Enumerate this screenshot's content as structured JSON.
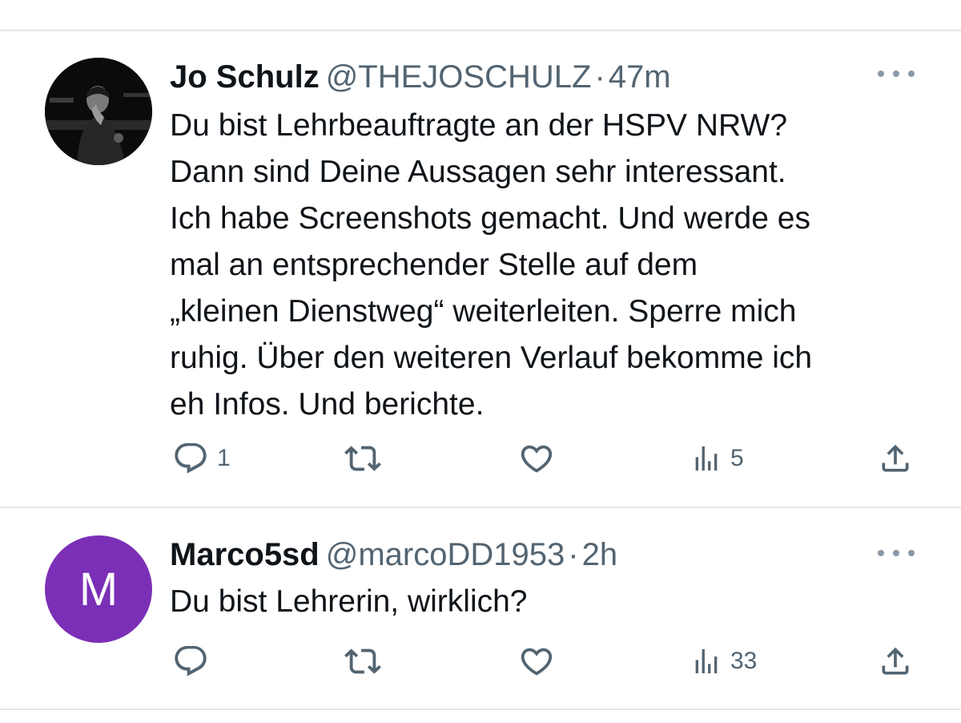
{
  "tweets": [
    {
      "name": "Jo Schulz",
      "handle": "@THEJOSCHULZ",
      "separator": "·",
      "time": "47m",
      "text_lines": [
        "Du bist Lehrbeauftragte an der HSPV NRW?",
        "Dann sind Deine Aussagen sehr interessant.",
        "Ich habe Screenshots gemacht. Und werde es",
        "mal an entsprechender Stelle auf dem",
        "„kleinen Dienstweg“ weiterleiten. Sperre mich",
        "ruhig. Über den weiteren Verlauf bekomme ich",
        "eh Infos. Und berichte."
      ],
      "avatar": {
        "type": "photo"
      },
      "reply_count": "1",
      "views_count": "5"
    },
    {
      "name": "Marco5sd",
      "handle": "@marcoDD1953",
      "separator": "·",
      "time": "2h",
      "text_lines": [
        "Du bist Lehrerin, wirklich?"
      ],
      "avatar": {
        "type": "letter",
        "letter": "M",
        "color": "#7b2fb7"
      },
      "reply_count": "",
      "views_count": "33"
    }
  ],
  "icons": {
    "reply": "reply-icon",
    "retweet": "retweet-icon",
    "like": "heart-icon",
    "views": "views-icon",
    "share": "share-icon",
    "more": "more-icon"
  },
  "colors": {
    "text": "#0f1419",
    "secondary": "#536471",
    "divider": "#e3e6e9",
    "avatar_purple": "#7b2fb7"
  }
}
